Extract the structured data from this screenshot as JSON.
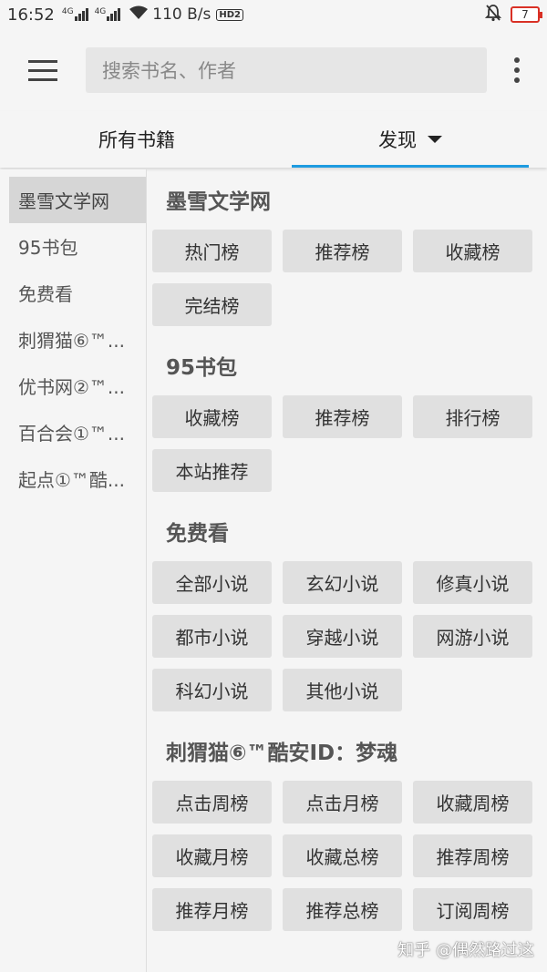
{
  "status_bar": {
    "time": "16:52",
    "sim1": "4G",
    "sim2": "4G",
    "net_speed": "110 B/s",
    "hd_badge": "HD2",
    "battery": "7",
    "battery_color": "#d93025"
  },
  "toolbar": {
    "search_placeholder": "搜索书名、作者"
  },
  "tabs": [
    {
      "label": "所有书籍"
    },
    {
      "label": "发现"
    }
  ],
  "accent_color": "#1e9be0",
  "sidebar": {
    "items": [
      {
        "label": "墨雪文学网"
      },
      {
        "label": "95书包"
      },
      {
        "label": "免费看"
      },
      {
        "label": "刺猬猫⑥™..."
      },
      {
        "label": "优书网②™..."
      },
      {
        "label": "百合会①™..."
      },
      {
        "label": "起点①™酷..."
      }
    ]
  },
  "sections": [
    {
      "title": "墨雪文学网",
      "items": [
        "热门榜",
        "推荐榜",
        "收藏榜",
        "完结榜"
      ]
    },
    {
      "title": "95书包",
      "items": [
        "收藏榜",
        "推荐榜",
        "排行榜",
        "本站推荐"
      ]
    },
    {
      "title": "免费看",
      "items": [
        "全部小说",
        "玄幻小说",
        "修真小说",
        "都市小说",
        "穿越小说",
        "网游小说",
        "科幻小说",
        "其他小说"
      ]
    },
    {
      "title": "刺猬猫⑥™酷安ID：梦魂",
      "items": [
        "点击周榜",
        "点击月榜",
        "收藏周榜",
        "收藏月榜",
        "收藏总榜",
        "推荐周榜",
        "推荐月榜",
        "推荐总榜",
        "订阅周榜"
      ]
    }
  ],
  "watermark": "知乎 @偶然路过这"
}
